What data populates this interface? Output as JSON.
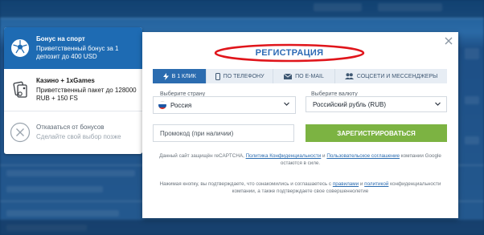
{
  "bonus_panel": {
    "items": [
      {
        "title": "Бонус на спорт",
        "subtitle": "Приветственный бонус за 1 депозит до 400 USD",
        "icon": "soccer-ball-icon"
      },
      {
        "title": "Казино + 1xGames",
        "subtitle": "Приветственный пакет до 128000 RUB + 150 FS",
        "icon": "casino-cards-icon"
      },
      {
        "title": "Отказаться от бонусов",
        "subtitle": "Сделайте свой выбор позже",
        "icon": "close-circle-icon"
      }
    ]
  },
  "modal": {
    "title": "РЕГИСТРАЦИЯ",
    "tabs": [
      {
        "label": "В 1 КЛИК",
        "icon": "lightning-icon"
      },
      {
        "label": "ПО ТЕЛЕФОНУ",
        "icon": "phone-icon"
      },
      {
        "label": "ПО E-MAIL",
        "icon": "envelope-icon"
      },
      {
        "label": "СОЦСЕТИ И МЕССЕНДЖЕРЫ",
        "icon": "people-icon"
      }
    ],
    "country": {
      "label": "Выберите страну",
      "value": "Россия"
    },
    "currency": {
      "label": "Выберите валюту",
      "value": "Российский рубль (RUB)"
    },
    "promo_placeholder": "Промокод (при наличии)",
    "register_button": "ЗАРЕГИСТРИРОВАТЬСЯ",
    "recaptcha": {
      "prefix": "Данный сайт защищён reCAPTCHA, ",
      "privacy_link": "Политика Конфиденциальности",
      "and": " и ",
      "terms_link": "Пользовательское соглашение",
      "suffix": " компании Google остаются в силе."
    },
    "consent": {
      "prefix": "Нажимая кнопку, вы подтверждаете, что ознакомились и соглашаетесь с ",
      "rules_link": "правилами",
      "and": " и ",
      "policy_link": "политикой",
      "suffix": " конфиденциальности компании, а также подтверждаете свое совершеннолетие"
    }
  },
  "colors": {
    "accent": "#2b6cb0",
    "register": "#7cb342",
    "highlight_oval": "#e0151b",
    "active_bonus": "#1e6bb3"
  }
}
